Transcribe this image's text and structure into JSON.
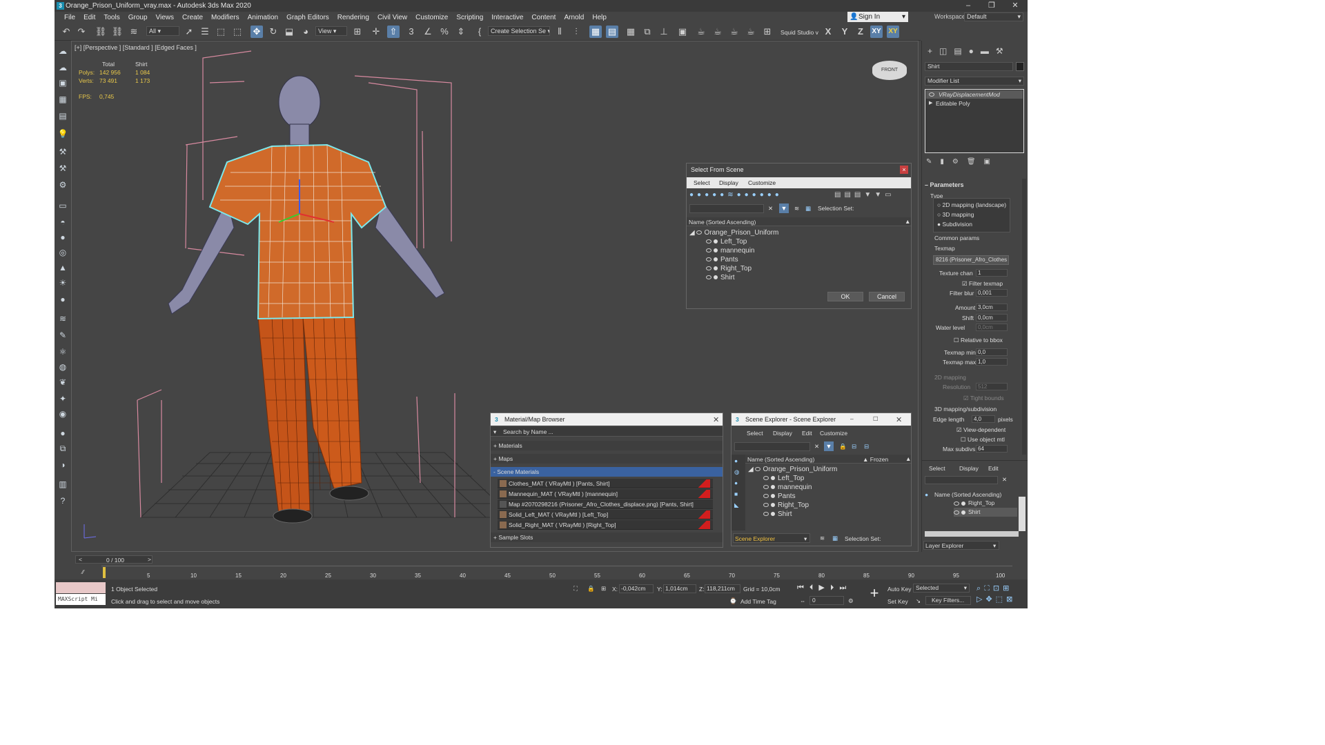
{
  "window": {
    "title": "Orange_Prison_Uniform_vray.max - Autodesk 3ds Max 2020"
  },
  "menu": [
    "File",
    "Edit",
    "Tools",
    "Group",
    "Views",
    "Create",
    "Modifiers",
    "Animation",
    "Graph Editors",
    "Rendering",
    "Civil View",
    "Customize",
    "Scripting",
    "Interactive",
    "Content",
    "Arnold",
    "Help"
  ],
  "account": {
    "sign_in": "Sign In",
    "workspaces_label": "Workspaces:",
    "workspace": "Default"
  },
  "toolbar": {
    "filter": "All",
    "view": "View",
    "selection_set": "Create Selection Se",
    "squid": "Squid Studio v",
    "axes": [
      "X",
      "Y",
      "Z",
      "XY",
      "XY"
    ]
  },
  "viewport": {
    "label": "[+] [Perspective ] [Standard ] [Edged Faces ]",
    "stats": {
      "h_total": "Total",
      "h_shirt": "Shirt",
      "polys_label": "Polys:",
      "polys_total": "142 956",
      "polys_shirt": "1 084",
      "verts_label": "Verts:",
      "verts_total": "73 491",
      "verts_shirt": "1 173",
      "fps_label": "FPS:",
      "fps": "0,745"
    },
    "cube_label": "FRONT"
  },
  "command_panel": {
    "object_name": "Shirt",
    "modifier_list": "Modifier List",
    "stack": [
      "VRayDisplacementMod",
      "Editable Poly"
    ],
    "parameters": "Parameters",
    "type_label": "Type",
    "types": [
      "2D mapping (landscape)",
      "3D mapping",
      "Subdivision"
    ],
    "common": "Common params",
    "texmap_label": "Texmap",
    "texmap": "8216 (Prisoner_Afro_Clothes",
    "texture_chan_label": "Texture chan",
    "texture_chan": "1",
    "filter_texmap": "Filter texmap",
    "filter_blur_label": "Filter blur",
    "filter_blur": "0,001",
    "amount_label": "Amount",
    "amount": "3,0cm",
    "shift_label": "Shift",
    "shift": "0,0cm",
    "water_label": "Water level",
    "water": "0,0cm",
    "relative": "Relative to bbox",
    "texmap_min_label": "Texmap min",
    "texmap_min": "0,0",
    "texmap_max_label": "Texmap max",
    "texmap_max": "1,0",
    "mapping2d": "2D mapping",
    "resolution_label": "Resolution",
    "resolution": "512",
    "tight": "Tight bounds",
    "mapping3d": "3D mapping/subdivision",
    "edge_label": "Edge length",
    "edge": "4,0",
    "pixels": "pixels",
    "view_dep": "View-dependent",
    "use_obj": "Use object mtl",
    "max_subdivs_label": "Max subdivs",
    "max_subdivs": "64"
  },
  "layer_panel": {
    "menu": [
      "Select",
      "Display",
      "Edit"
    ],
    "header": "Name (Sorted Ascending)",
    "rows": [
      "Right_Top",
      "Shirt"
    ],
    "footer": "Layer Explorer"
  },
  "select_dialog": {
    "title": "Select From Scene",
    "menu": [
      "Select",
      "Display",
      "Customize"
    ],
    "selection_set": "Selection Set:",
    "header": "Name (Sorted Ascending)",
    "root": "Orange_Prison_Uniform",
    "items": [
      "Left_Top",
      "mannequin",
      "Pants",
      "Right_Top",
      "Shirt"
    ],
    "ok": "OK",
    "cancel": "Cancel"
  },
  "material_browser": {
    "title": "Material/Map Browser",
    "search": "Search by Name ...",
    "groups": [
      "+ Materials",
      "+ Maps",
      "- Scene Materials",
      "+ Sample Slots"
    ],
    "materials": [
      "Clothes_MAT ( VRayMtl ) [Pants, Shirt]",
      "Mannequin_MAT ( VRayMtl ) [mannequin]",
      "Map #2070298216 (Prisoner_Afro_Clothes_displace.png) [Pants, Shirt]",
      "Solid_Left_MAT ( VRayMtl ) [Left_Top]",
      "Solid_Right_MAT ( VRayMtl ) [Right_Top]"
    ]
  },
  "scene_explorer": {
    "title": "Scene Explorer - Scene Explorer",
    "menu": [
      "Select",
      "Display",
      "Edit",
      "Customize"
    ],
    "header": "Name (Sorted Ascending)",
    "frozen": "▲ Frozen",
    "root": "Orange_Prison_Uniform",
    "items": [
      "Left_Top",
      "mannequin",
      "Pants",
      "Right_Top",
      "Shirt"
    ],
    "footer": "Scene Explorer",
    "selection_set": "Selection Set:"
  },
  "timeline": {
    "frame": "0 / 100",
    "ticks": [
      "5",
      "10",
      "15",
      "20",
      "25",
      "30",
      "35",
      "40",
      "45",
      "50",
      "55",
      "60",
      "65",
      "70",
      "75",
      "80",
      "85",
      "90",
      "95",
      "100"
    ]
  },
  "status": {
    "script": "MAXScript Mi",
    "selected": "1 Object Selected",
    "hint": "Click and drag to select and move objects",
    "x_label": "X:",
    "x": "-0,042cm",
    "y_label": "Y:",
    "y": "1,014cm",
    "z_label": "Z:",
    "z": "118,211cm",
    "grid": "Grid = 10,0cm",
    "add_time_tag": "Add Time Tag",
    "auto_key": "Auto Key",
    "selected_mode": "Selected",
    "set_key": "Set Key",
    "key_filters": "Key Filters...",
    "frame_field": "0"
  }
}
